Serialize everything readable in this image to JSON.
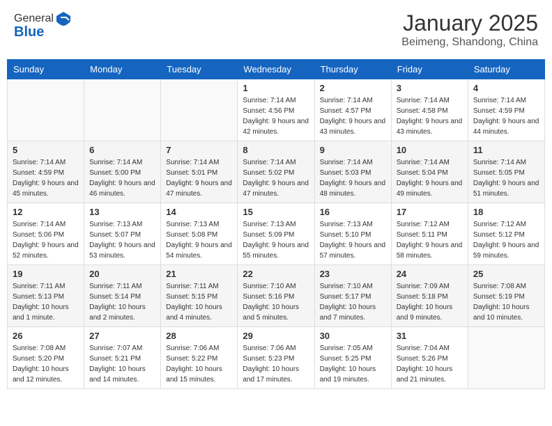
{
  "header": {
    "logo_line1": "General",
    "logo_line2": "Blue",
    "month": "January 2025",
    "location": "Beimeng, Shandong, China"
  },
  "weekdays": [
    "Sunday",
    "Monday",
    "Tuesday",
    "Wednesday",
    "Thursday",
    "Friday",
    "Saturday"
  ],
  "weeks": [
    [
      {
        "day": "",
        "sunrise": "",
        "sunset": "",
        "daylight": ""
      },
      {
        "day": "",
        "sunrise": "",
        "sunset": "",
        "daylight": ""
      },
      {
        "day": "",
        "sunrise": "",
        "sunset": "",
        "daylight": ""
      },
      {
        "day": "1",
        "sunrise": "7:14 AM",
        "sunset": "4:56 PM",
        "daylight": "9 hours and 42 minutes."
      },
      {
        "day": "2",
        "sunrise": "7:14 AM",
        "sunset": "4:57 PM",
        "daylight": "9 hours and 43 minutes."
      },
      {
        "day": "3",
        "sunrise": "7:14 AM",
        "sunset": "4:58 PM",
        "daylight": "9 hours and 43 minutes."
      },
      {
        "day": "4",
        "sunrise": "7:14 AM",
        "sunset": "4:59 PM",
        "daylight": "9 hours and 44 minutes."
      }
    ],
    [
      {
        "day": "5",
        "sunrise": "7:14 AM",
        "sunset": "4:59 PM",
        "daylight": "9 hours and 45 minutes."
      },
      {
        "day": "6",
        "sunrise": "7:14 AM",
        "sunset": "5:00 PM",
        "daylight": "9 hours and 46 minutes."
      },
      {
        "day": "7",
        "sunrise": "7:14 AM",
        "sunset": "5:01 PM",
        "daylight": "9 hours and 47 minutes."
      },
      {
        "day": "8",
        "sunrise": "7:14 AM",
        "sunset": "5:02 PM",
        "daylight": "9 hours and 47 minutes."
      },
      {
        "day": "9",
        "sunrise": "7:14 AM",
        "sunset": "5:03 PM",
        "daylight": "9 hours and 48 minutes."
      },
      {
        "day": "10",
        "sunrise": "7:14 AM",
        "sunset": "5:04 PM",
        "daylight": "9 hours and 49 minutes."
      },
      {
        "day": "11",
        "sunrise": "7:14 AM",
        "sunset": "5:05 PM",
        "daylight": "9 hours and 51 minutes."
      }
    ],
    [
      {
        "day": "12",
        "sunrise": "7:14 AM",
        "sunset": "5:06 PM",
        "daylight": "9 hours and 52 minutes."
      },
      {
        "day": "13",
        "sunrise": "7:13 AM",
        "sunset": "5:07 PM",
        "daylight": "9 hours and 53 minutes."
      },
      {
        "day": "14",
        "sunrise": "7:13 AM",
        "sunset": "5:08 PM",
        "daylight": "9 hours and 54 minutes."
      },
      {
        "day": "15",
        "sunrise": "7:13 AM",
        "sunset": "5:09 PM",
        "daylight": "9 hours and 55 minutes."
      },
      {
        "day": "16",
        "sunrise": "7:13 AM",
        "sunset": "5:10 PM",
        "daylight": "9 hours and 57 minutes."
      },
      {
        "day": "17",
        "sunrise": "7:12 AM",
        "sunset": "5:11 PM",
        "daylight": "9 hours and 58 minutes."
      },
      {
        "day": "18",
        "sunrise": "7:12 AM",
        "sunset": "5:12 PM",
        "daylight": "9 hours and 59 minutes."
      }
    ],
    [
      {
        "day": "19",
        "sunrise": "7:11 AM",
        "sunset": "5:13 PM",
        "daylight": "10 hours and 1 minute."
      },
      {
        "day": "20",
        "sunrise": "7:11 AM",
        "sunset": "5:14 PM",
        "daylight": "10 hours and 2 minutes."
      },
      {
        "day": "21",
        "sunrise": "7:11 AM",
        "sunset": "5:15 PM",
        "daylight": "10 hours and 4 minutes."
      },
      {
        "day": "22",
        "sunrise": "7:10 AM",
        "sunset": "5:16 PM",
        "daylight": "10 hours and 5 minutes."
      },
      {
        "day": "23",
        "sunrise": "7:10 AM",
        "sunset": "5:17 PM",
        "daylight": "10 hours and 7 minutes."
      },
      {
        "day": "24",
        "sunrise": "7:09 AM",
        "sunset": "5:18 PM",
        "daylight": "10 hours and 9 minutes."
      },
      {
        "day": "25",
        "sunrise": "7:08 AM",
        "sunset": "5:19 PM",
        "daylight": "10 hours and 10 minutes."
      }
    ],
    [
      {
        "day": "26",
        "sunrise": "7:08 AM",
        "sunset": "5:20 PM",
        "daylight": "10 hours and 12 minutes."
      },
      {
        "day": "27",
        "sunrise": "7:07 AM",
        "sunset": "5:21 PM",
        "daylight": "10 hours and 14 minutes."
      },
      {
        "day": "28",
        "sunrise": "7:06 AM",
        "sunset": "5:22 PM",
        "daylight": "10 hours and 15 minutes."
      },
      {
        "day": "29",
        "sunrise": "7:06 AM",
        "sunset": "5:23 PM",
        "daylight": "10 hours and 17 minutes."
      },
      {
        "day": "30",
        "sunrise": "7:05 AM",
        "sunset": "5:25 PM",
        "daylight": "10 hours and 19 minutes."
      },
      {
        "day": "31",
        "sunrise": "7:04 AM",
        "sunset": "5:26 PM",
        "daylight": "10 hours and 21 minutes."
      },
      {
        "day": "",
        "sunrise": "",
        "sunset": "",
        "daylight": ""
      }
    ]
  ]
}
